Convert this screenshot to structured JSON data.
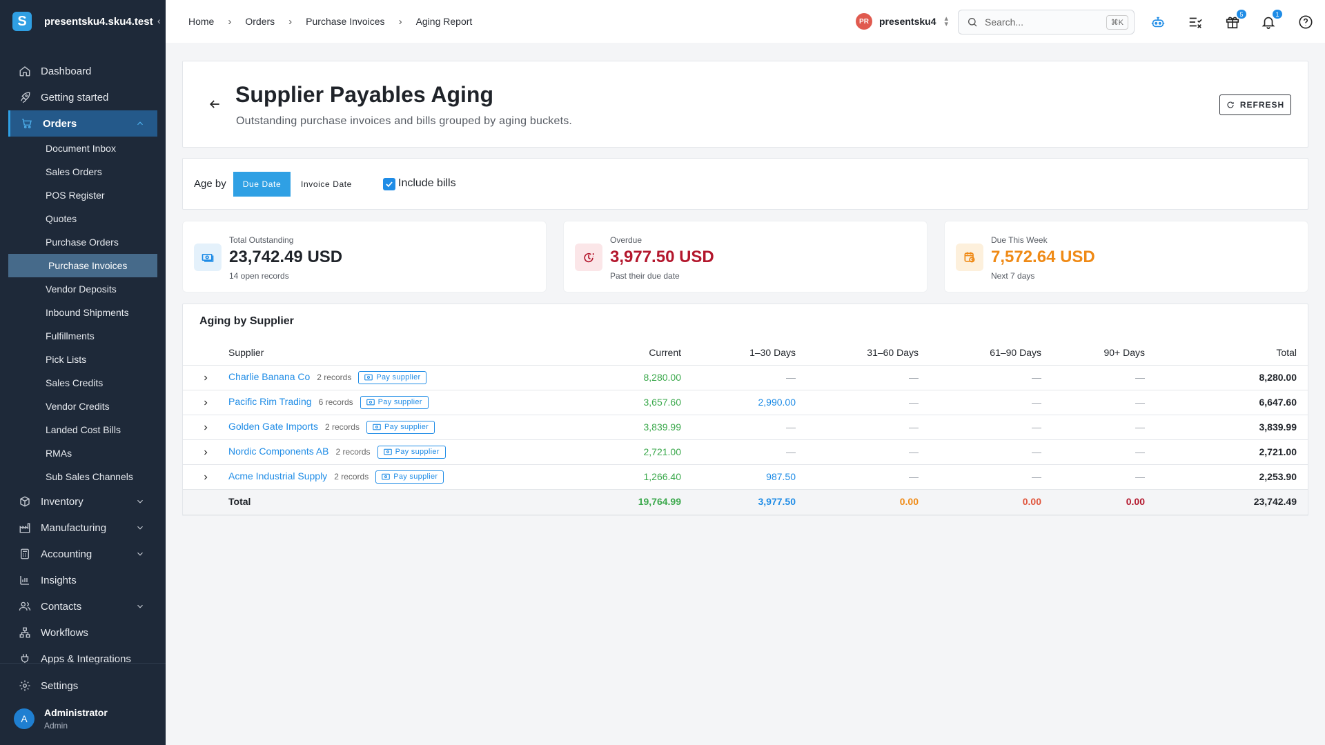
{
  "app": {
    "brand_logo": "S",
    "brand_name": "presentsku4.sku4.test",
    "collapse": "‹"
  },
  "sidebar": {
    "items": [
      {
        "label": "Dashboard"
      },
      {
        "label": "Getting started"
      },
      {
        "label": "Orders"
      },
      {
        "label": "Inventory"
      },
      {
        "label": "Manufacturing"
      },
      {
        "label": "Accounting"
      },
      {
        "label": "Insights"
      },
      {
        "label": "Contacts"
      },
      {
        "label": "Workflows"
      },
      {
        "label": "Apps & Integrations"
      }
    ],
    "orders_sub": [
      "Document Inbox",
      "Sales Orders",
      "POS Register",
      "Quotes",
      "Purchase Orders",
      "Purchase Invoices",
      "Vendor Deposits",
      "Inbound Shipments",
      "Fulfillments",
      "Pick Lists",
      "Sales Credits",
      "Vendor Credits",
      "Landed Cost Bills",
      "RMAs",
      "Sub Sales Channels"
    ],
    "settings": "Settings",
    "user": {
      "initial": "A",
      "name": "Administrator",
      "role": "Admin"
    }
  },
  "topbar": {
    "breadcrumbs": [
      "Home",
      "Orders",
      "Purchase Invoices",
      "Aging Report"
    ],
    "separator": "›",
    "company_initials": "PR",
    "company_name": "presentsku4",
    "search_placeholder": "Search...",
    "search_shortcut": "⌘K",
    "gift_badge": "5",
    "bell_badge": "1"
  },
  "page": {
    "title": "Supplier Payables Aging",
    "subtitle": "Outstanding purchase invoices and bills grouped by aging buckets.",
    "refresh_label": "REFRESH"
  },
  "filters": {
    "age_by_label": "Age by",
    "options": [
      "Due Date",
      "Invoice Date"
    ],
    "selected": "Due Date",
    "include_bills_label": "Include bills",
    "include_bills_checked": true
  },
  "cards": [
    {
      "label": "Total Outstanding",
      "value": "23,742.49 USD",
      "note": "14 open records",
      "color": "#1f2329",
      "icon_bg": "#e4f1fb",
      "icon_color": "#1f8ce6"
    },
    {
      "label": "Overdue",
      "value": "3,977.50 USD",
      "note": "Past their due date",
      "color": "#b3172d",
      "icon_bg": "#fbe6e8",
      "icon_color": "#b3172d"
    },
    {
      "label": "Due This Week",
      "value": "7,572.64 USD",
      "note": "Next 7 days",
      "color": "#ef8a16",
      "icon_bg": "#fdf0dc",
      "icon_color": "#ef8a16"
    }
  ],
  "aging_table": {
    "title": "Aging by Supplier",
    "columns": [
      "Supplier",
      "Current",
      "1–30 Days",
      "31–60 Days",
      "61–90 Days",
      "90+ Days",
      "Total"
    ],
    "pay_label": "Pay supplier",
    "rows": [
      {
        "supplier": "Charlie Banana Co",
        "records": "2 records",
        "current": "8,280.00",
        "d1_30": "—",
        "d31_60": "—",
        "d61_90": "—",
        "d90": "—",
        "total": "8,280.00"
      },
      {
        "supplier": "Pacific Rim Trading",
        "records": "6 records",
        "current": "3,657.60",
        "d1_30": "2,990.00",
        "d31_60": "—",
        "d61_90": "—",
        "d90": "—",
        "total": "6,647.60"
      },
      {
        "supplier": "Golden Gate Imports",
        "records": "2 records",
        "current": "3,839.99",
        "d1_30": "—",
        "d31_60": "—",
        "d61_90": "—",
        "d90": "—",
        "total": "3,839.99"
      },
      {
        "supplier": "Nordic Components AB",
        "records": "2 records",
        "current": "2,721.00",
        "d1_30": "—",
        "d31_60": "—",
        "d61_90": "—",
        "d90": "—",
        "total": "2,721.00"
      },
      {
        "supplier": "Acme Industrial Supply",
        "records": "2 records",
        "current": "1,266.40",
        "d1_30": "987.50",
        "d31_60": "—",
        "d61_90": "—",
        "d90": "—",
        "total": "2,253.90"
      }
    ],
    "totals": {
      "label": "Total",
      "current": "19,764.99",
      "d1_30": "3,977.50",
      "d31_60": "0.00",
      "d61_90": "0.00",
      "d90": "0.00",
      "total": "23,742.49"
    }
  }
}
